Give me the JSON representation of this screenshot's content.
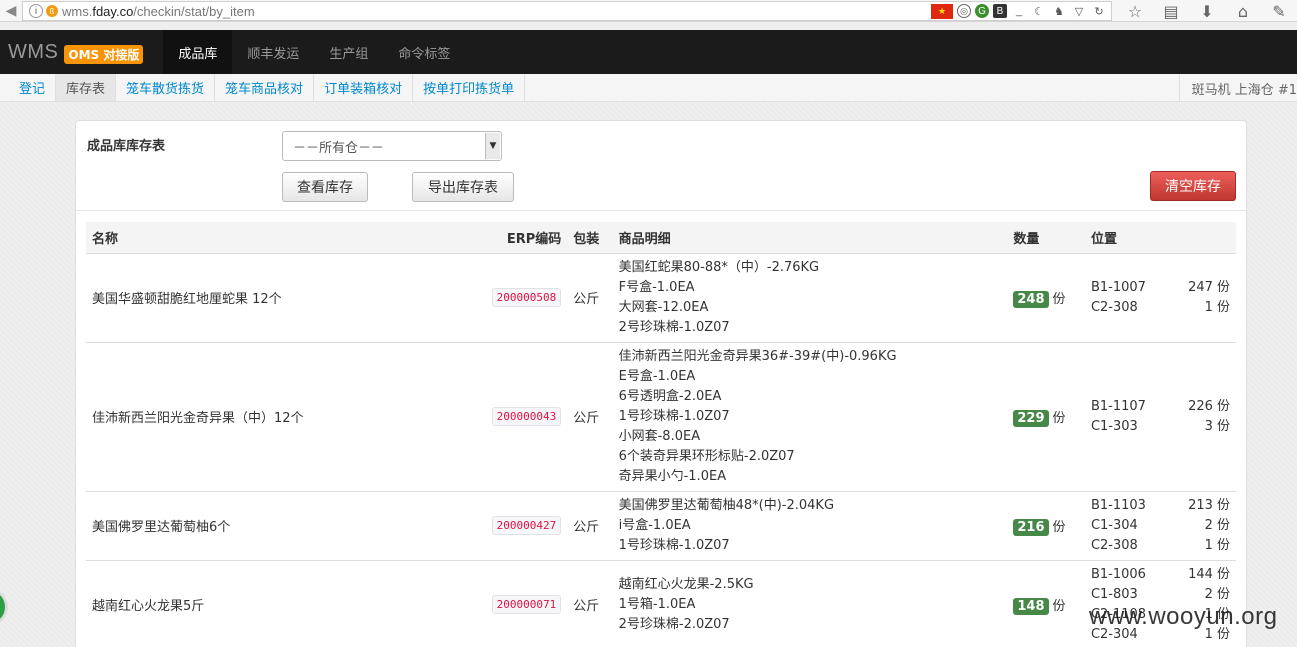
{
  "browser": {
    "url_prefix": "wms.",
    "url_domain": "fday.co",
    "url_path": "/checkin/stat/by_item"
  },
  "navbar": {
    "brand": "WMS",
    "badge": "OMS 对接版",
    "items": [
      "成品库",
      "顺丰发运",
      "生产组",
      "命令标签"
    ]
  },
  "subnav": {
    "items": [
      "登记",
      "库存表",
      "笼车散货拣货",
      "笼车商品核对",
      "订单装箱核对",
      "按单打印拣货单"
    ],
    "right_text": "斑马机 上海仓 #1"
  },
  "panel": {
    "title": "成品库库存表",
    "warehouse_select": "－－所有仓－－",
    "view_button": "查看库存",
    "export_button": "导出库存表",
    "clear_button": "清空库存"
  },
  "table": {
    "headers": {
      "name": "名称",
      "erp": "ERP编码",
      "pack": "包装",
      "detail": "商品明细",
      "qty": "数量",
      "loc": "位置"
    },
    "unit": "份",
    "rows": [
      {
        "name": "美国华盛顿甜脆红地厘蛇果 12个",
        "erp": "200000508",
        "pack": "公斤",
        "details": [
          "美国红蛇果80-88*（中）-2.76KG",
          "F号盒-1.0EA",
          "大网套-12.0EA",
          "2号珍珠棉-1.0Z07"
        ],
        "qty": "248",
        "locations": [
          {
            "code": "B1-1007",
            "qty": "247"
          },
          {
            "code": "C2-308",
            "qty": "1"
          }
        ]
      },
      {
        "name": "佳沛新西兰阳光金奇异果（中）12个",
        "erp": "200000043",
        "pack": "公斤",
        "details": [
          "佳沛新西兰阳光金奇异果36#-39#(中)-0.96KG",
          "E号盒-1.0EA",
          "6号透明盒-2.0EA",
          "1号珍珠棉-1.0Z07",
          "小网套-8.0EA",
          "6个装奇异果环形标贴-2.0Z07",
          "奇异果小勺-1.0EA"
        ],
        "qty": "229",
        "locations": [
          {
            "code": "B1-1107",
            "qty": "226"
          },
          {
            "code": "C1-303",
            "qty": "3"
          }
        ]
      },
      {
        "name": "美国佛罗里达葡萄柚6个",
        "erp": "200000427",
        "pack": "公斤",
        "details": [
          "美国佛罗里达葡萄柚48*(中)-2.04KG",
          "i号盒-1.0EA",
          "1号珍珠棉-1.0Z07"
        ],
        "qty": "216",
        "locations": [
          {
            "code": "B1-1103",
            "qty": "213"
          },
          {
            "code": "C1-304",
            "qty": "2"
          },
          {
            "code": "C2-308",
            "qty": "1"
          }
        ]
      },
      {
        "name": "越南红心火龙果5斤",
        "erp": "200000071",
        "pack": "公斤",
        "details": [
          "越南红心火龙果-2.5KG",
          "1号箱-1.0EA",
          "2号珍珠棉-2.0Z07"
        ],
        "qty": "148",
        "locations": [
          {
            "code": "B1-1006",
            "qty": "144"
          },
          {
            "code": "C1-803",
            "qty": "2"
          },
          {
            "code": "C2-1108",
            "qty": "1"
          },
          {
            "code": "C2-304",
            "qty": "1"
          }
        ]
      }
    ]
  },
  "watermark": "www.wooyun.org"
}
